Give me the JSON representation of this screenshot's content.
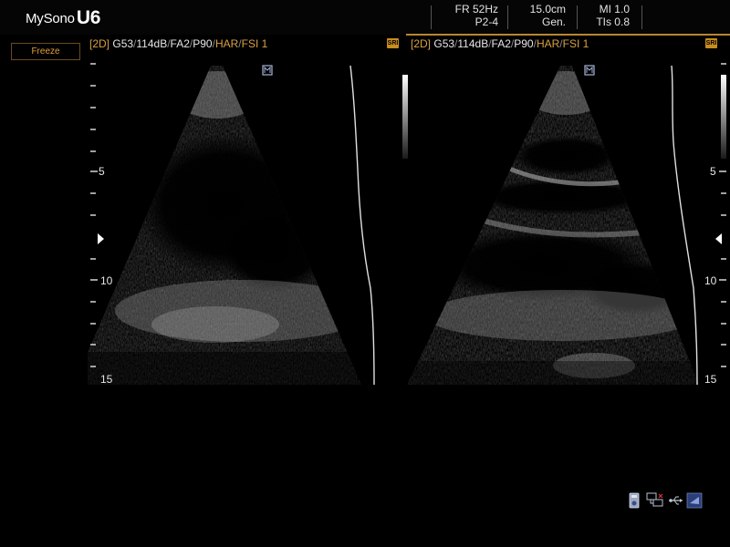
{
  "header": {
    "brand": "MySono",
    "model": "U6",
    "frame_rate": "FR 52Hz",
    "probe_preset": "P2-4",
    "depth": "15.0cm",
    "mode": "Gen.",
    "mi": "MI 1.0",
    "tis": "TIs 0.8"
  },
  "controls": {
    "freeze_label": "Freeze"
  },
  "left_image": {
    "mode_tag": "[2D]",
    "gain": "G53",
    "dynamic_range": "114dB",
    "frame_avg": "FA2",
    "power": "P90",
    "harmonic": "HAR",
    "fsi": "FSI 1",
    "badge": "SRI",
    "depth_labels": [
      "5",
      "10",
      "15"
    ]
  },
  "right_image": {
    "mode_tag": "[2D]",
    "gain": "G53",
    "dynamic_range": "114dB",
    "frame_avg": "FA2",
    "power": "P90",
    "harmonic": "HAR",
    "fsi": "FSI 1",
    "badge": "SRI",
    "depth_labels": [
      "5",
      "10",
      "15"
    ]
  },
  "colors": {
    "accent": "#b8862f",
    "background": "#000000",
    "text": "#e6e6e6",
    "highlight": "#d8a040"
  },
  "icons": [
    "probe-orientation-marker-icon",
    "focus-marker-icon",
    "storage-icon",
    "network-icon",
    "usb-icon",
    "printer-icon"
  ]
}
